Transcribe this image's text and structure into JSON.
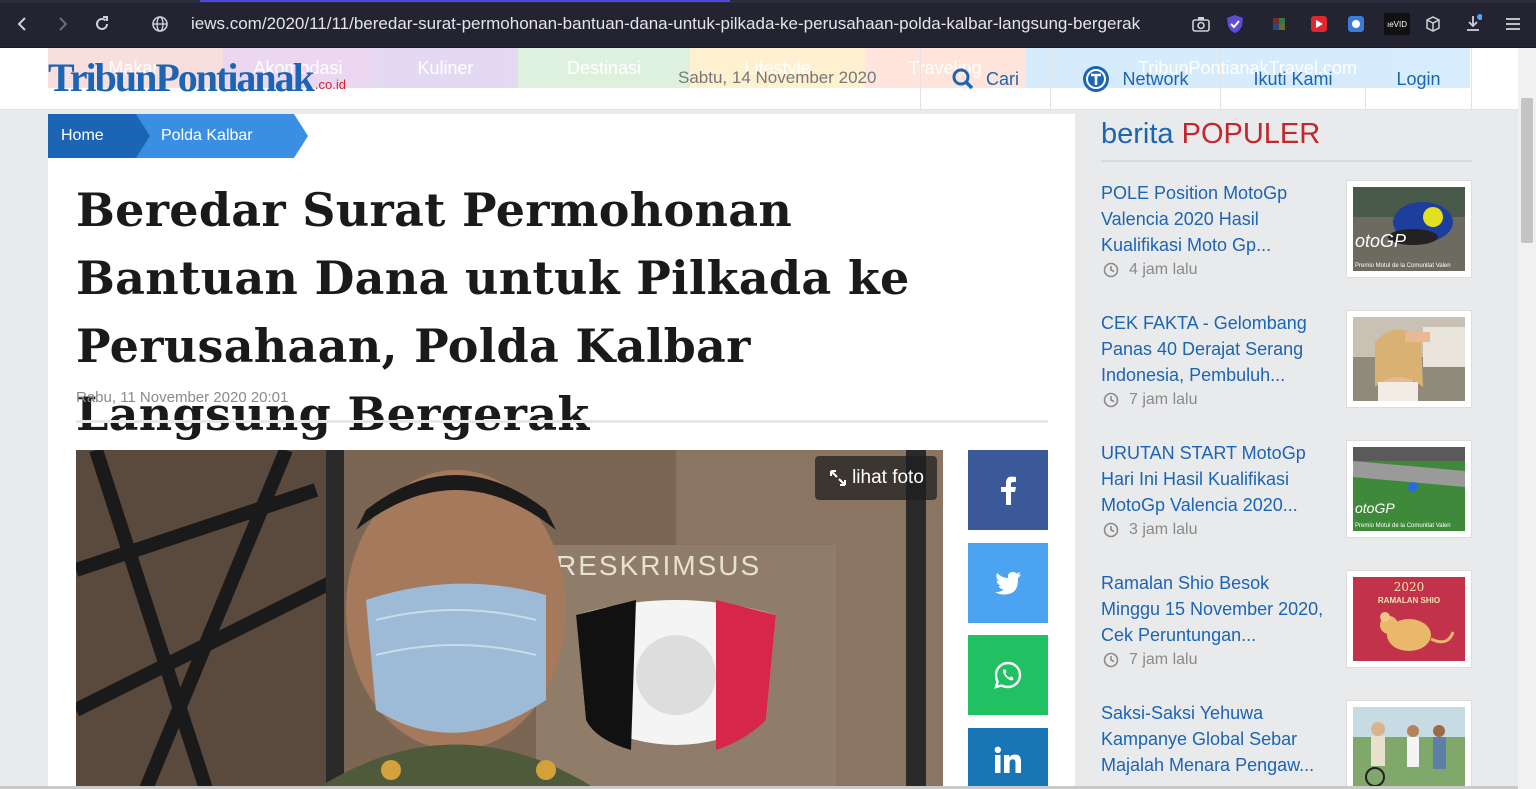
{
  "browser": {
    "url": "iews.com/2020/11/11/beredar-surat-permohonan-bantuan-dana-untuk-pilkada-ke-perusahaan-polda-kalbar-langsung-bergerak",
    "ext_label_vid": "ıeVID"
  },
  "header": {
    "logo_name": "TribunPontianak",
    "logo_tld": ".co.id",
    "ghost_menu": [
      "Makan",
      "Akomodasi",
      "Kuliner",
      "Destinasi",
      "Lifestyle",
      "Traveling",
      "TribunPontianakTravel.com"
    ],
    "date": "Sabtu, 14 November 2020",
    "search_label": "Cari",
    "network_label": "Network",
    "follow_label": "Ikuti Kami",
    "login_label": "Login"
  },
  "breadcrumb": {
    "home": "Home",
    "category": "Polda Kalbar"
  },
  "article": {
    "title": "Beredar Surat Permohonan Bantuan Dana untuk Pilkada ke Perusahaan, Polda Kalbar Langsung Bergerak",
    "date": "Rabu, 11 November 2020 20:01",
    "photo_button": "lihat foto",
    "photo_wall_text": "RESKRIMSUS"
  },
  "sidebar": {
    "title_prefix": "berita",
    "title_highlight": "POPULER",
    "items": [
      {
        "title": "POLE Position MotoGp Valencia 2020 Hasil Kualifikasi Moto Gp...",
        "time": "4 jam lalu",
        "thumb_caption": "Premio Motul de la Comunitat Valen",
        "thumb_badge": "otoGP"
      },
      {
        "title": "CEK FAKTA - Gelombang Panas 40 Derajat Serang Indonesia, Pembuluh...",
        "time": "7 jam lalu"
      },
      {
        "title": "URUTAN START MotoGp Hari Ini Hasil Kualifikasi MotoGp Valencia 2020...",
        "time": "3 jam lalu",
        "thumb_caption": "Premio Motul de la Comunitat Valen",
        "thumb_badge": "otoGP"
      },
      {
        "title": "Ramalan Shio Besok Minggu 15 November 2020, Cek Peruntungan...",
        "time": "7 jam lalu",
        "thumb_year": "2020",
        "thumb_caption": "RAMALAN SHIO"
      },
      {
        "title": "Saksi-Saksi Yehuwa Kampanye Global Sebar Majalah Menara Pengaw...",
        "time": ""
      }
    ]
  },
  "colors": {
    "brand_blue": "#1c64b4",
    "accent_red": "#c4262e",
    "facebook": "#3b5998",
    "twitter": "#4ba3f1",
    "whatsapp": "#21c063",
    "linkedin": "#1976b6"
  }
}
